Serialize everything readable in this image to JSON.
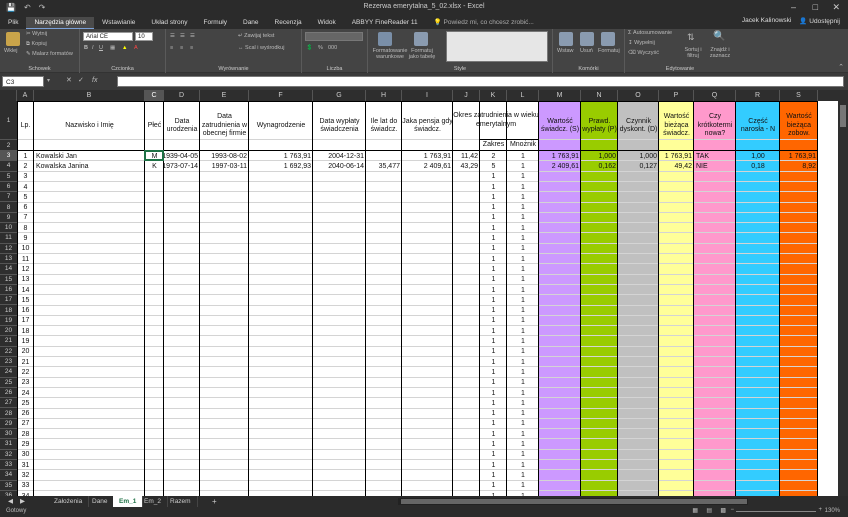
{
  "window": {
    "title": "Rezerwa emerytalna_5_02.xlsx - Excel",
    "min_icon": "minimize-icon",
    "max_icon": "maximize-icon",
    "close_icon": "close-icon"
  },
  "ribbon_tabs": [
    {
      "label": "Plik",
      "active": false
    },
    {
      "label": "Narzędzia główne",
      "active": true
    },
    {
      "label": "Wstawianie",
      "active": false
    },
    {
      "label": "Układ strony",
      "active": false
    },
    {
      "label": "Formuły",
      "active": false
    },
    {
      "label": "Dane",
      "active": false
    },
    {
      "label": "Recenzja",
      "active": false
    },
    {
      "label": "Widok",
      "active": false
    },
    {
      "label": "ABBYY FineReader 11",
      "active": false
    }
  ],
  "tellme": "Powiedz mi, co chcesz zrobić...",
  "user": {
    "name": "Jacek Kalinowski",
    "share": "Udostępnij"
  },
  "ribbon": {
    "paste": "Wklej",
    "cut": "Wytnij",
    "copy": "Kopiuj",
    "format_painter": "Malarz formatów",
    "clipboard": "Schowek",
    "font_name": "Arial CE",
    "font_size": "10",
    "font": "Czcionka",
    "wrap_text": "Zawijaj tekst",
    "merge": "Scal i wyśrodkuj",
    "alignment": "Wyrównanie",
    "number": "Liczba",
    "cond_format": "Formatowanie warunkowe",
    "format_table": "Formatuj jako tabelę",
    "styles": "Style",
    "insert": "Wstaw",
    "delete": "Usuń",
    "format": "Formatuj",
    "cells": "Komórki",
    "autosum": "Autosumowanie",
    "fill": "Wypełnij",
    "clear": "Wyczyść",
    "sort": "Sortuj i filtruj",
    "find": "Znajdź i zaznacz",
    "editing": "Edytowanie"
  },
  "namebox": "C3",
  "fx": "fx",
  "columns": [
    "A",
    "B",
    "C",
    "D",
    "E",
    "F",
    "G",
    "H",
    "I",
    "J",
    "K",
    "L",
    "M",
    "N",
    "O",
    "P",
    "Q",
    "R",
    "S"
  ],
  "headers": {
    "lp": "Lp.",
    "name": "Nazwisko i Imię",
    "sex": "Płeć",
    "birth": "Data urodzenia",
    "hire": "Data zatrudnienia w obecnej firmie",
    "salary": "Wynagrodzenie",
    "payout": "Data wypłaty świadczenia",
    "years": "Ile lat do świadcz.",
    "pension": "Jaka pensja gdy świadcz.",
    "period": "Okres zatrudnienia w wieku emerytalnym",
    "range": "Zakres",
    "mult": "Mnożnik",
    "val_s": "Wartość świadcz. (S)",
    "prob": "Prawd. wypłaty (P)",
    "disc": "Czynnik dyskont. (D)",
    "cur": "Wartość bieżąca świadcz.",
    "short": "Czy krótkotermi nowa?",
    "part": "Część narosła - N",
    "liab": "Wartość bieżąca zobow."
  },
  "rows": [
    {
      "lp": "1",
      "name": "Kowalski Jan",
      "sex": "M",
      "birth": "1939-04-05",
      "hire": "1993-08-02",
      "salary": "1 763,91",
      "payout": "2004-12-31",
      "years": "",
      "pension": "1 763,91",
      "j": "11,42",
      "k": "2",
      "l": "1",
      "m": "1 763,91",
      "n": "1,000",
      "o": "1,000",
      "p": "1 763,91",
      "q": "TAK",
      "r": "1,00",
      "s": "1 763,91"
    },
    {
      "lp": "2",
      "name": "Kowalska Janina",
      "sex": "K",
      "birth": "1973-07-14",
      "hire": "1997-03-11",
      "salary": "1 692,93",
      "payout": "2040-06-14",
      "years": "35,477",
      "pension": "2 409,61",
      "j": "43,29",
      "k": "5",
      "l": "1",
      "m": "2 409,61",
      "n": "0,162",
      "o": "0,127",
      "p": "49,42",
      "q": "NIE",
      "r": "0,18",
      "s": "8,92"
    }
  ],
  "empty_lp": [
    "3",
    "4",
    "5",
    "6",
    "7",
    "8",
    "9",
    "10",
    "11",
    "12",
    "13",
    "14",
    "15",
    "16",
    "17",
    "18",
    "19",
    "20",
    "21",
    "22",
    "23",
    "24",
    "25",
    "26",
    "27",
    "28",
    "29",
    "30",
    "31",
    "32",
    "33",
    "34"
  ],
  "empty_k": "1",
  "empty_l": "1",
  "row_numbers": [
    "1",
    "2",
    "3",
    "4",
    "5",
    "6",
    "7",
    "8",
    "9",
    "10",
    "11",
    "12",
    "13",
    "14",
    "15",
    "16",
    "17",
    "18",
    "19",
    "20",
    "21",
    "22",
    "23",
    "24",
    "25",
    "26",
    "27",
    "28",
    "29",
    "30",
    "31",
    "32",
    "33",
    "34",
    "35",
    "36"
  ],
  "col_colors": {
    "M": "#cc99ff",
    "N": "#99cc00",
    "O": "#c0c0c0",
    "P": "#ffff99",
    "Q": "#ff99cc",
    "R": "#33ccff",
    "S": "#ff6600"
  },
  "sheets": [
    {
      "label": "Założenia",
      "active": false
    },
    {
      "label": "Dane",
      "active": false
    },
    {
      "label": "Em_1",
      "active": true
    },
    {
      "label": "Em_2",
      "active": false
    },
    {
      "label": "Razem",
      "active": false
    }
  ],
  "add_sheet": "+",
  "status": "Gotowy",
  "zoom": "130%"
}
